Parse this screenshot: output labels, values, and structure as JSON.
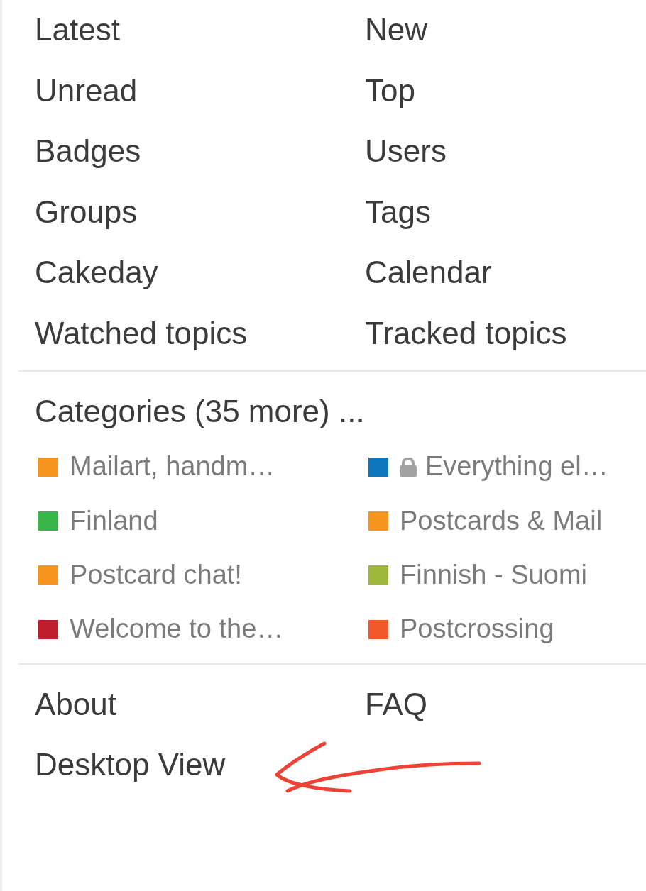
{
  "nav_links": [
    {
      "label": "Latest"
    },
    {
      "label": "New"
    },
    {
      "label": "Unread"
    },
    {
      "label": "Top"
    },
    {
      "label": "Badges"
    },
    {
      "label": "Users"
    },
    {
      "label": "Groups"
    },
    {
      "label": "Tags"
    },
    {
      "label": "Cakeday"
    },
    {
      "label": "Calendar"
    },
    {
      "label": "Watched topics"
    },
    {
      "label": "Tracked topics"
    }
  ],
  "categories": {
    "heading": "Categories (35 more) ...",
    "items": [
      {
        "name": "Mailart, handm…",
        "color": "#f7941d",
        "locked": false
      },
      {
        "name": "Everything el…",
        "color": "#0e76bd",
        "locked": true
      },
      {
        "name": "Finland",
        "color": "#3ab54a",
        "locked": false
      },
      {
        "name": "Postcards & Mail",
        "color": "#f7941d",
        "locked": false
      },
      {
        "name": "Postcard chat!",
        "color": "#f7941d",
        "locked": false
      },
      {
        "name": "Finnish - Suomi",
        "color": "#9eb83b",
        "locked": false
      },
      {
        "name": "Welcome to the…",
        "color": "#bf1e2e",
        "locked": false
      },
      {
        "name": "Postcrossing",
        "color": "#f1592a",
        "locked": false
      }
    ]
  },
  "footer_links": [
    {
      "label": "About"
    },
    {
      "label": "FAQ"
    },
    {
      "label": "Desktop View"
    }
  ],
  "annotation": {
    "kind": "arrow"
  }
}
